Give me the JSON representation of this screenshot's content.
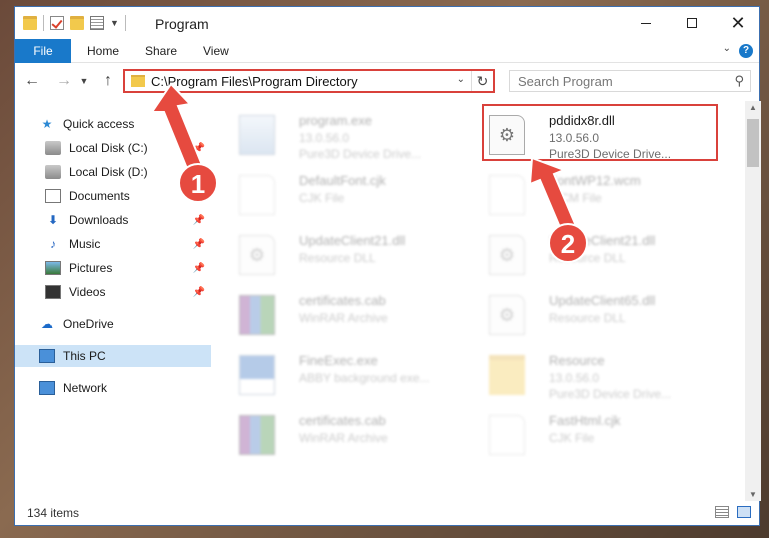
{
  "window": {
    "title": "Program"
  },
  "ribbon": {
    "tabs": [
      "File",
      "Home",
      "Share",
      "View"
    ]
  },
  "address": {
    "path": "C:\\Program Files\\Program Directory"
  },
  "search": {
    "placeholder": "Search Program"
  },
  "sidebar": {
    "items": [
      {
        "label": "Quick access",
        "icon": "star-icon"
      },
      {
        "label": "Local Disk (C:)",
        "icon": "disk-icon",
        "pinned": true
      },
      {
        "label": "Local Disk (D:)",
        "icon": "disk-icon",
        "pinned": true
      },
      {
        "label": "Documents",
        "icon": "documents-icon",
        "pinned": true
      },
      {
        "label": "Downloads",
        "icon": "download-icon",
        "pinned": true
      },
      {
        "label": "Music",
        "icon": "music-icon",
        "pinned": true
      },
      {
        "label": "Pictures",
        "icon": "pictures-icon",
        "pinned": true
      },
      {
        "label": "Videos",
        "icon": "videos-icon",
        "pinned": true
      },
      {
        "label": "OneDrive",
        "icon": "cloud-icon"
      },
      {
        "label": "This PC",
        "icon": "pc-icon",
        "selected": true
      },
      {
        "label": "Network",
        "icon": "network-icon"
      }
    ]
  },
  "files": [
    {
      "name": "program.exe",
      "line2": "13.0.56.0",
      "line3": "Pure3D Device Drive...",
      "icon": "exe-icon",
      "faded": true
    },
    {
      "name": "pddidx8r.dll",
      "line2": "13.0.56.0",
      "line3": "Pure3D Device Drive...",
      "icon": "dll-gear-icon",
      "faded": false
    },
    {
      "name": "DefaultFont.cjk",
      "line2": "CJK File",
      "line3": "",
      "icon": "document-icon",
      "faded": true
    },
    {
      "name": "FontWP12.wcm",
      "line2": "WCM File",
      "line3": "",
      "icon": "document-icon",
      "faded": true
    },
    {
      "name": "UpdateClient21.dll",
      "line2": "Resource DLL",
      "line3": "",
      "icon": "dll-gear-icon",
      "faded": true
    },
    {
      "name": "UpdateClient21.dll",
      "line2": "Resource DLL",
      "line3": "",
      "icon": "dll-gear-icon",
      "faded": true
    },
    {
      "name": "certificates.cab",
      "line2": "WinRAR Archive",
      "line3": "",
      "icon": "rar-icon",
      "faded": true
    },
    {
      "name": "UpdateClient65.dll",
      "line2": "Resource DLL",
      "line3": "",
      "icon": "dll-gear-icon",
      "faded": true
    },
    {
      "name": "FineExec.exe",
      "line2": "ABBY background exe...",
      "line3": "",
      "icon": "blue-exe-icon",
      "faded": true
    },
    {
      "name": "Resource",
      "line2": "13.0.56.0",
      "line3": "Pure3D Device Drive...",
      "icon": "folder-icon",
      "faded": true
    },
    {
      "name": "certificates.cab",
      "line2": "WinRAR Archive",
      "line3": "",
      "icon": "rar-icon",
      "faded": true
    },
    {
      "name": "FastHtml.cjk",
      "line2": "CJK File",
      "line3": "",
      "icon": "document-icon",
      "faded": true
    }
  ],
  "status": {
    "item_count": "134 items"
  },
  "annotations": {
    "badge1": "1",
    "badge2": "2",
    "accent": "#d9413b"
  }
}
